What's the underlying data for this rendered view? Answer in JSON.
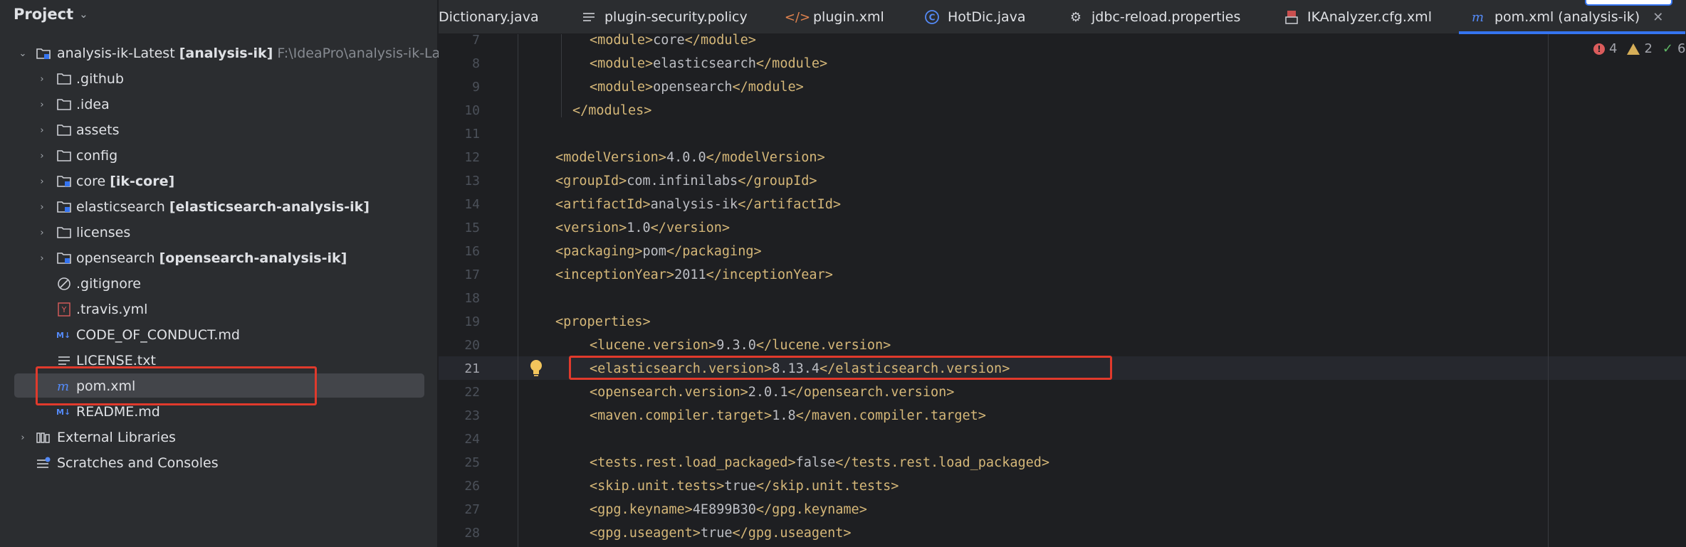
{
  "project": {
    "title": "Project",
    "root": {
      "name": "analysis-ik-Latest",
      "module": "[analysis-ik]",
      "path": "F:\\IdeaPro\\analysis-ik-La"
    },
    "items": [
      {
        "name": ".github",
        "module": ""
      },
      {
        "name": ".idea",
        "module": ""
      },
      {
        "name": "assets",
        "module": ""
      },
      {
        "name": "config",
        "module": ""
      },
      {
        "name": "core",
        "module": "[ik-core]"
      },
      {
        "name": "elasticsearch",
        "module": "[elasticsearch-analysis-ik]"
      },
      {
        "name": "licenses",
        "module": ""
      },
      {
        "name": "opensearch",
        "module": "[opensearch-analysis-ik]"
      }
    ],
    "files": [
      {
        "name": ".gitignore"
      },
      {
        "name": ".travis.yml"
      },
      {
        "name": "CODE_OF_CONDUCT.md"
      },
      {
        "name": "LICENSE.txt"
      },
      {
        "name": "pom.xml"
      },
      {
        "name": "README.md"
      }
    ],
    "external_libraries": "External Libraries",
    "scratches": "Scratches and Consoles"
  },
  "tabs": [
    {
      "label": "Dictionary.java"
    },
    {
      "label": "plugin-security.policy"
    },
    {
      "label": "plugin.xml"
    },
    {
      "label": "HotDic.java"
    },
    {
      "label": "jdbc-reload.properties"
    },
    {
      "label": "IKAnalyzer.cfg.xml"
    },
    {
      "label": "pom.xml (analysis-ik)"
    }
  ],
  "inspections": {
    "errors": "4",
    "warnings": "2",
    "ok": "6"
  },
  "editor": {
    "active_line": 21,
    "lines": [
      {
        "n": "7",
        "code": "<module>core</module>"
      },
      {
        "n": "8",
        "code": "<module>elasticsearch</module>"
      },
      {
        "n": "9",
        "code": "<module>opensearch</module>"
      },
      {
        "n": "10",
        "code": "</modules>"
      },
      {
        "n": "11",
        "code": ""
      },
      {
        "n": "12",
        "code": "<modelVersion>4.0.0</modelVersion>"
      },
      {
        "n": "13",
        "code": "<groupId>com.infinilabs</groupId>"
      },
      {
        "n": "14",
        "code": "<artifactId>analysis-ik</artifactId>"
      },
      {
        "n": "15",
        "code": "<version>1.0</version>"
      },
      {
        "n": "16",
        "code": "<packaging>pom</packaging>"
      },
      {
        "n": "17",
        "code": "<inceptionYear>2011</inceptionYear>"
      },
      {
        "n": "18",
        "code": ""
      },
      {
        "n": "19",
        "code": "<properties>"
      },
      {
        "n": "20",
        "code": "<lucene.version>9.3.0</lucene.version>"
      },
      {
        "n": "21",
        "code": "<elasticsearch.version>8.13.4</elasticsearch.version>"
      },
      {
        "n": "22",
        "code": "<opensearch.version>2.0.1</opensearch.version>"
      },
      {
        "n": "23",
        "code": "<maven.compiler.target>1.8</maven.compiler.target>"
      },
      {
        "n": "24",
        "code": ""
      },
      {
        "n": "25",
        "code": "<tests.rest.load_packaged>false</tests.rest.load_packaged>"
      },
      {
        "n": "26",
        "code": "<skip.unit.tests>true</skip.unit.tests>"
      },
      {
        "n": "27",
        "code": "<gpg.keyname>4E899B30</gpg.keyname>"
      },
      {
        "n": "28",
        "code": "<gpg.useagent>true</gpg.useagent>"
      }
    ]
  },
  "colors": {
    "accent": "#3574f0",
    "highlight_box": "#e03a2c",
    "xml_tag": "#d5b778",
    "xml_text": "#bcbec4"
  }
}
